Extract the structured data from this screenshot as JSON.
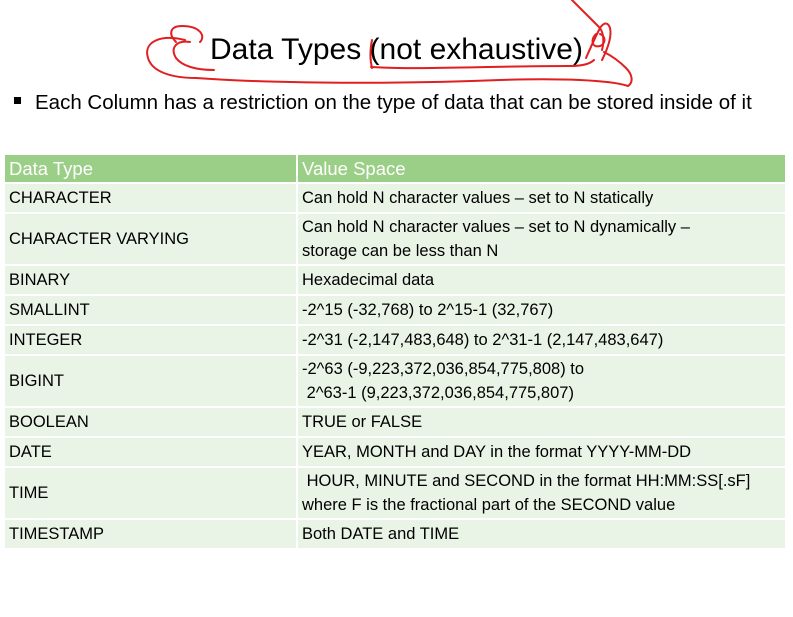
{
  "title": "Data Types (not exhaustive)",
  "bullet": "Each Column has a restriction on the type of data that can be stored inside of it",
  "table": {
    "headers": [
      "Data Type",
      "Value Space"
    ],
    "rows": [
      {
        "type": "CHARACTER",
        "value": [
          "Can hold N character values – set to N statically"
        ]
      },
      {
        "type": "CHARACTER VARYING",
        "value": [
          "Can hold N character values – set to N dynamically –",
          "storage can be less than N"
        ]
      },
      {
        "type": "BINARY",
        "value": [
          "Hexadecimal data"
        ]
      },
      {
        "type": "SMALLINT",
        "value": [
          "-2^15 (-32,768) to 2^15-1 (32,767)"
        ]
      },
      {
        "type": "INTEGER",
        "value": [
          "-2^31 (-2,147,483,648) to 2^31-1 (2,147,483,647)"
        ]
      },
      {
        "type": "BIGINT",
        "value": [
          "-2^63 (-9,223,372,036,854,775,808) to",
          " 2^63-1 (9,223,372,036,854,775,807)"
        ]
      },
      {
        "type": "BOOLEAN",
        "value": [
          "TRUE or FALSE"
        ]
      },
      {
        "type": "DATE",
        "value": [
          "YEAR, MONTH and DAY in the format YYYY-MM-DD"
        ]
      },
      {
        "type": "TIME",
        "value": [
          " HOUR, MINUTE and SECOND in the format HH:MM:SS[.sF]",
          "where F is the fractional part of the SECOND value"
        ]
      },
      {
        "type": "TIMESTAMP",
        "value": [
          "Both DATE and TIME"
        ]
      }
    ]
  },
  "colors": {
    "header_bg": "#9bce86",
    "row_bg": "#eaf4e6",
    "ink": "#e02020"
  }
}
